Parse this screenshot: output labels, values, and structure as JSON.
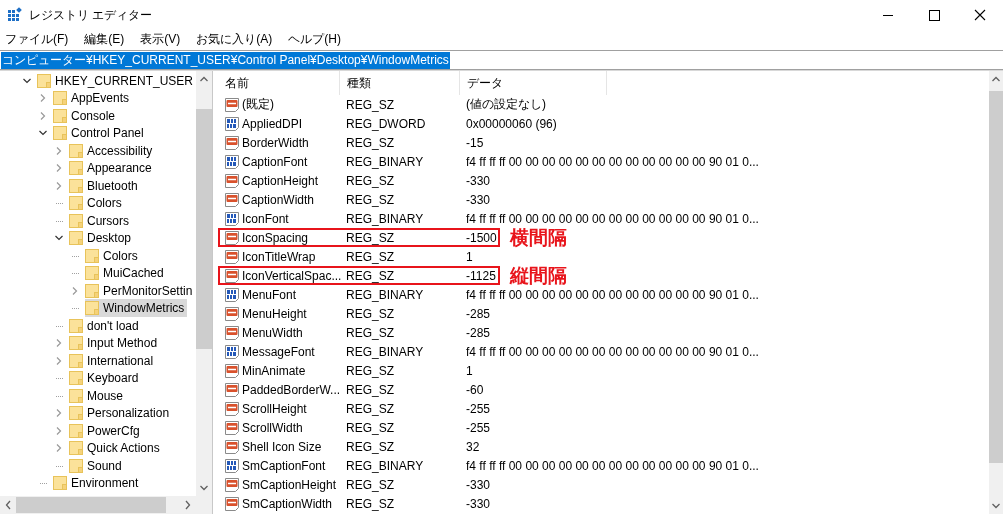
{
  "window": {
    "title": "レジストリ エディター"
  },
  "menu": [
    "ファイル(F)",
    "編集(E)",
    "表示(V)",
    "お気に入り(A)",
    "ヘルプ(H)"
  ],
  "address_bar": {
    "value": "コンピューター¥HKEY_CURRENT_USER¥Control Panel¥Desktop¥WindowMetrics",
    "text_selected": true
  },
  "tree": [
    {
      "label": "HKEY_CURRENT_USER",
      "kind": "branch",
      "expanded": true,
      "selected": false,
      "children": [
        {
          "label": "AppEvents",
          "kind": "branch",
          "expanded": false,
          "selected": false
        },
        {
          "label": "Console",
          "kind": "branch",
          "expanded": false,
          "selected": false
        },
        {
          "label": "Control Panel",
          "kind": "branch",
          "expanded": true,
          "selected": false,
          "children": [
            {
              "label": "Accessibility",
              "kind": "branch",
              "expanded": false,
              "selected": false
            },
            {
              "label": "Appearance",
              "kind": "branch",
              "expanded": false,
              "selected": false
            },
            {
              "label": "Bluetooth",
              "kind": "branch",
              "expanded": false,
              "selected": false
            },
            {
              "label": "Colors",
              "kind": "leaf",
              "selected": false
            },
            {
              "label": "Cursors",
              "kind": "leaf",
              "selected": false
            },
            {
              "label": "Desktop",
              "kind": "branch",
              "expanded": true,
              "selected": false,
              "children": [
                {
                  "label": "Colors",
                  "kind": "leaf",
                  "selected": false
                },
                {
                  "label": "MuiCached",
                  "kind": "leaf",
                  "selected": false
                },
                {
                  "label": "PerMonitorSettin",
                  "kind": "branch",
                  "expanded": false,
                  "selected": false
                },
                {
                  "label": "WindowMetrics",
                  "kind": "leaf",
                  "selected": true
                }
              ]
            },
            {
              "label": "don't load",
              "kind": "leaf",
              "selected": false
            },
            {
              "label": "Input Method",
              "kind": "branch",
              "expanded": false,
              "selected": false
            },
            {
              "label": "International",
              "kind": "branch",
              "expanded": false,
              "selected": false
            },
            {
              "label": "Keyboard",
              "kind": "leaf",
              "selected": false
            },
            {
              "label": "Mouse",
              "kind": "leaf",
              "selected": false
            },
            {
              "label": "Personalization",
              "kind": "branch",
              "expanded": false,
              "selected": false
            },
            {
              "label": "PowerCfg",
              "kind": "branch",
              "expanded": false,
              "selected": false
            },
            {
              "label": "Quick Actions",
              "kind": "branch",
              "expanded": false,
              "selected": false
            },
            {
              "label": "Sound",
              "kind": "leaf",
              "selected": false
            }
          ]
        },
        {
          "label": "Environment",
          "kind": "leaf",
          "selected": false
        }
      ]
    }
  ],
  "table": {
    "columns": [
      "名前",
      "種類",
      "データ"
    ],
    "rows": [
      {
        "kind": "string",
        "name": "(既定)",
        "type": "REG_SZ",
        "data": "(値の設定なし)",
        "marked": false
      },
      {
        "kind": "binary",
        "name": "AppliedDPI",
        "type": "REG_DWORD",
        "data": "0x00000060 (96)",
        "marked": false
      },
      {
        "kind": "string",
        "name": "BorderWidth",
        "type": "REG_SZ",
        "data": "-15",
        "marked": false
      },
      {
        "kind": "binary",
        "name": "CaptionFont",
        "type": "REG_BINARY",
        "data": "f4 ff ff ff 00 00 00 00 00 00 00 00 00 00 00 00 90 01 0...",
        "marked": false
      },
      {
        "kind": "string",
        "name": "CaptionHeight",
        "type": "REG_SZ",
        "data": "-330",
        "marked": false
      },
      {
        "kind": "string",
        "name": "CaptionWidth",
        "type": "REG_SZ",
        "data": "-330",
        "marked": false
      },
      {
        "kind": "binary",
        "name": "IconFont",
        "type": "REG_BINARY",
        "data": "f4 ff ff ff 00 00 00 00 00 00 00 00 00 00 00 00 90 01 0...",
        "marked": false
      },
      {
        "kind": "string",
        "name": "IconSpacing",
        "type": "REG_SZ",
        "data": "-1500",
        "marked": true,
        "note": "横間隔"
      },
      {
        "kind": "string",
        "name": "IconTitleWrap",
        "type": "REG_SZ",
        "data": "1",
        "marked": false
      },
      {
        "kind": "string",
        "name": "IconVerticalSpac...",
        "type": "REG_SZ",
        "data": "-1125",
        "marked": true,
        "note": "縦間隔"
      },
      {
        "kind": "binary",
        "name": "MenuFont",
        "type": "REG_BINARY",
        "data": "f4 ff ff ff 00 00 00 00 00 00 00 00 00 00 00 00 90 01 0...",
        "marked": false
      },
      {
        "kind": "string",
        "name": "MenuHeight",
        "type": "REG_SZ",
        "data": "-285",
        "marked": false
      },
      {
        "kind": "string",
        "name": "MenuWidth",
        "type": "REG_SZ",
        "data": "-285",
        "marked": false
      },
      {
        "kind": "binary",
        "name": "MessageFont",
        "type": "REG_BINARY",
        "data": "f4 ff ff ff 00 00 00 00 00 00 00 00 00 00 00 00 90 01 0...",
        "marked": false
      },
      {
        "kind": "string",
        "name": "MinAnimate",
        "type": "REG_SZ",
        "data": "1",
        "marked": false
      },
      {
        "kind": "string",
        "name": "PaddedBorderW...",
        "type": "REG_SZ",
        "data": "-60",
        "marked": false
      },
      {
        "kind": "string",
        "name": "ScrollHeight",
        "type": "REG_SZ",
        "data": "-255",
        "marked": false
      },
      {
        "kind": "string",
        "name": "ScrollWidth",
        "type": "REG_SZ",
        "data": "-255",
        "marked": false
      },
      {
        "kind": "string",
        "name": "Shell Icon Size",
        "type": "REG_SZ",
        "data": "32",
        "marked": false
      },
      {
        "kind": "binary",
        "name": "SmCaptionFont",
        "type": "REG_BINARY",
        "data": "f4 ff ff ff 00 00 00 00 00 00 00 00 00 00 00 00 90 01 0...",
        "marked": false
      },
      {
        "kind": "string",
        "name": "SmCaptionHeight",
        "type": "REG_SZ",
        "data": "-330",
        "marked": false
      },
      {
        "kind": "string",
        "name": "SmCaptionWidth",
        "type": "REG_SZ",
        "data": "-330",
        "marked": false
      }
    ]
  }
}
